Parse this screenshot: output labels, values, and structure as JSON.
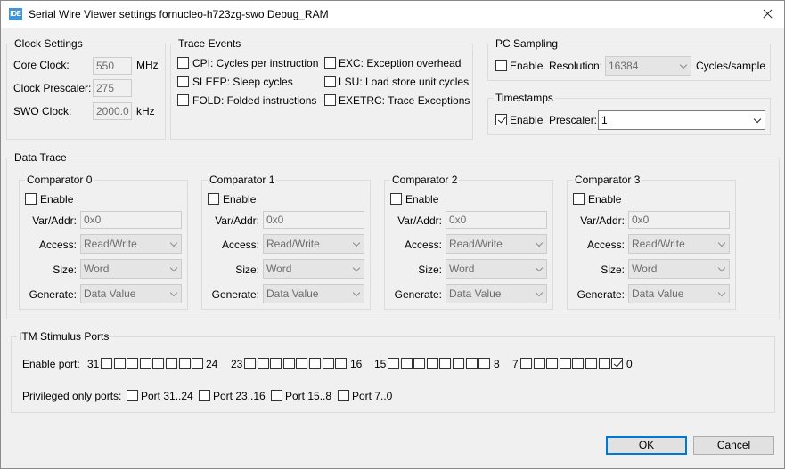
{
  "window": {
    "icon_text": "IDE",
    "title": "Serial Wire Viewer settings fornucleo-h723zg-swo Debug_RAM"
  },
  "clock": {
    "title": "Clock Settings",
    "core_label": "Core Clock:",
    "core_value": "550",
    "core_unit": "MHz",
    "prescaler_label": "Clock Prescaler:",
    "prescaler_value": "275",
    "swo_label": "SWO Clock:",
    "swo_value": "2000.0",
    "swo_unit": "kHz"
  },
  "trace": {
    "title": "Trace Events",
    "events": [
      {
        "label": "CPI: Cycles per instruction",
        "checked": false
      },
      {
        "label": "SLEEP: Sleep cycles",
        "checked": false
      },
      {
        "label": "FOLD: Folded instructions",
        "checked": false
      },
      {
        "label": "EXC: Exception overhead",
        "checked": false
      },
      {
        "label": "LSU: Load store unit cycles",
        "checked": false
      },
      {
        "label": "EXETRC: Trace Exceptions",
        "checked": false
      }
    ]
  },
  "pc": {
    "title": "PC Sampling",
    "enable_label": "Enable",
    "enabled": false,
    "resolution_label": "Resolution:",
    "resolution_value": "16384",
    "unit": "Cycles/sample"
  },
  "timestamps": {
    "title": "Timestamps",
    "enable_label": "Enable",
    "enabled": true,
    "prescaler_label": "Prescaler:",
    "prescaler_value": "1"
  },
  "data_trace": {
    "title": "Data Trace",
    "comparators": [
      {
        "title": "Comparator 0",
        "enable_label": "Enable",
        "enabled": false,
        "var_label": "Var/Addr:",
        "var_placeholder": "0x0",
        "access_label": "Access:",
        "access_value": "Read/Write",
        "size_label": "Size:",
        "size_value": "Word",
        "generate_label": "Generate:",
        "generate_value": "Data Value"
      },
      {
        "title": "Comparator 1",
        "enable_label": "Enable",
        "enabled": false,
        "var_label": "Var/Addr:",
        "var_placeholder": "0x0",
        "access_label": "Access:",
        "access_value": "Read/Write",
        "size_label": "Size:",
        "size_value": "Word",
        "generate_label": "Generate:",
        "generate_value": "Data Value"
      },
      {
        "title": "Comparator 2",
        "enable_label": "Enable",
        "enabled": false,
        "var_label": "Var/Addr:",
        "var_placeholder": "0x0",
        "access_label": "Access:",
        "access_value": "Read/Write",
        "size_label": "Size:",
        "size_value": "Word",
        "generate_label": "Generate:",
        "generate_value": "Data Value"
      },
      {
        "title": "Comparator 3",
        "enable_label": "Enable",
        "enabled": false,
        "var_label": "Var/Addr:",
        "var_placeholder": "0x0",
        "access_label": "Access:",
        "access_value": "Read/Write",
        "size_label": "Size:",
        "size_value": "Word",
        "generate_label": "Generate:",
        "generate_value": "Data Value"
      }
    ]
  },
  "itm": {
    "title": "ITM Stimulus Ports",
    "enable_port_label": "Enable port:",
    "groups": [
      {
        "high": "31",
        "low": "24",
        "checked": [
          false,
          false,
          false,
          false,
          false,
          false,
          false,
          false
        ]
      },
      {
        "high": "23",
        "low": "16",
        "checked": [
          false,
          false,
          false,
          false,
          false,
          false,
          false,
          false
        ]
      },
      {
        "high": "15",
        "low": "8",
        "checked": [
          false,
          false,
          false,
          false,
          false,
          false,
          false,
          false
        ]
      },
      {
        "high": "7",
        "low": "0",
        "checked": [
          false,
          false,
          false,
          false,
          false,
          false,
          false,
          true
        ]
      }
    ],
    "privileged_label": "Privileged only ports:",
    "privileged": [
      {
        "label": "Port 31..24",
        "checked": false
      },
      {
        "label": "Port 23..16",
        "checked": false
      },
      {
        "label": "Port 15..8",
        "checked": false
      },
      {
        "label": "Port 7..0",
        "checked": false
      }
    ]
  },
  "buttons": {
    "ok": "OK",
    "cancel": "Cancel"
  }
}
